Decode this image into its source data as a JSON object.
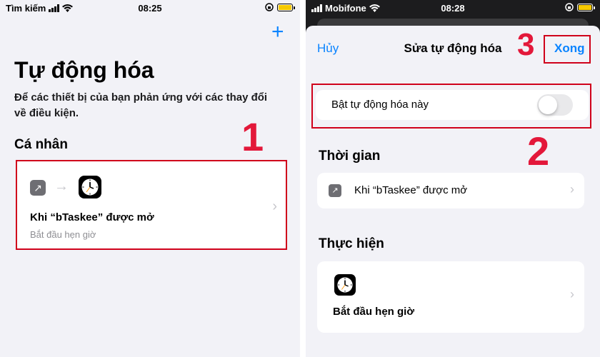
{
  "left_screen": {
    "status": {
      "carrier": "Tìm kiếm",
      "time": "08:25"
    },
    "add_label": "+",
    "title": "Tự động hóa",
    "subtitle": "Để các thiết bị của bạn phản ứng với các thay đổi về điều kiện.",
    "section_personal": "Cá nhân",
    "automation": {
      "title": "Khi “bTaskee” được mở",
      "subtitle": "Bắt đầu hẹn giờ",
      "flow_arrow": "→",
      "chevron": "›",
      "trigger_icon": "arrow-up-right-icon",
      "action_icon": "clock-icon"
    },
    "annotation": "1"
  },
  "right_screen": {
    "status": {
      "carrier": "Mobifone",
      "time": "08:28"
    },
    "nav": {
      "cancel": "Hủy",
      "title": "Sửa tự động hóa",
      "done": "Xong"
    },
    "toggle": {
      "label": "Bật tự động hóa này",
      "enabled": false
    },
    "section_time": "Thời gian",
    "trigger": {
      "label": "Khi “bTaskee” được mở",
      "chevron": "›"
    },
    "section_do": "Thực hiện",
    "action": {
      "title": "Bắt đầu hẹn giờ",
      "chevron": "›"
    },
    "annotations": {
      "toggle": "2",
      "done": "3"
    }
  },
  "colors": {
    "accent": "#0a84ff",
    "highlight": "#d0021b",
    "annotation": "#e3183a"
  }
}
